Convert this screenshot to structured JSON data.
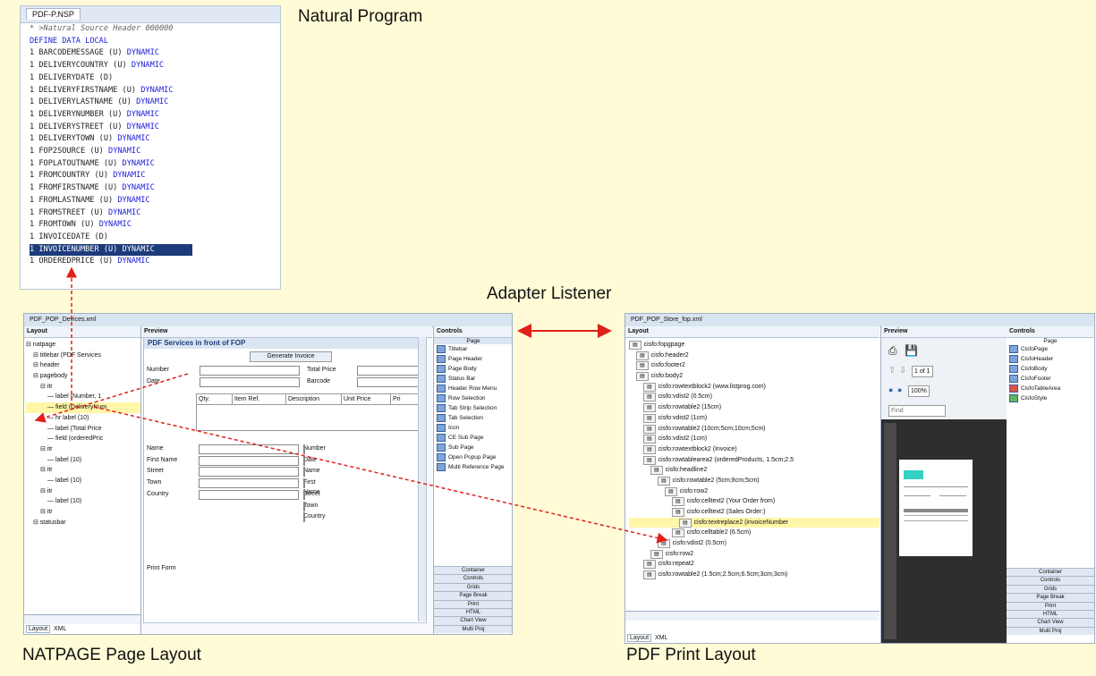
{
  "labels": {
    "natural_program": "Natural Program",
    "adapter_listener": "Adapter Listener",
    "natpage_layout": "NATPAGE Page Layout",
    "pdf_print_layout": "PDF Print Layout"
  },
  "code_editor": {
    "tab": "PDF-P.NSP",
    "lines": [
      "* >Natural Source Header 000000",
      "DEFINE DATA LOCAL",
      "1 BARCODEMESSAGE (U) DYNAMIC",
      "1 DELIVERYCOUNTRY (U) DYNAMIC",
      "1 DELIVERYDATE (D)",
      "1 DELIVERYFIRSTNAME (U) DYNAMIC",
      "1 DELIVERYLASTNAME (U) DYNAMIC",
      "1 DELIVERYNUMBER (U) DYNAMIC",
      "1 DELIVERYSTREET (U) DYNAMIC",
      "1 DELIVERYTOWN (U) DYNAMIC",
      "1 FOP2SOURCE (U) DYNAMIC",
      "1 FOPLATOUTNAME (U) DYNAMIC",
      "1 FROMCOUNTRY (U) DYNAMIC",
      "1 FROMFIRSTNAME (U) DYNAMIC",
      "1 FROMLASTNAME (U) DYNAMIC",
      "1 FROMSTREET (U) DYNAMIC",
      "1 FROMTOWN (U) DYNAMIC",
      "1 INVOICEDATE (D)",
      "1 INVOICENUMBER (U) DYNAMIC",
      "1 ORDEREDPRICE (U) DYNAMIC"
    ]
  },
  "natpage_window": {
    "tab": "PDF_POP_Devices.xml",
    "layout_header": "Layout",
    "preview_header": "Preview",
    "controls_header": "Controls",
    "tree": [
      "natpage",
      "titlebar (PDF Services",
      "header",
      "pagebody",
      "itr",
      "label (Number, 1",
      "field (DeliveryNum",
      "hr label (10)",
      "label (Total Price",
      "field (orderedPric",
      "itr",
      "label (10)",
      "itr",
      "label (10)",
      "itr",
      "label (10)",
      "itr",
      "statusbar"
    ],
    "preview_title": "PDF Services in front of FOP",
    "preview_button": "Generate Invoice",
    "form_left": [
      "Number",
      "Date"
    ],
    "form_right": [
      "Total Price",
      "Barcode"
    ],
    "grid_headers": [
      "Qty.",
      "Item Ref.",
      "Description",
      "Unit Price",
      "Pri"
    ],
    "from_fields": [
      "Name",
      "First Name",
      "Street",
      "Town",
      "Country"
    ],
    "to_fields": [
      "Number",
      "Date",
      "Name",
      "First Name",
      "Street",
      "Town",
      "Country"
    ],
    "print_form": "Print Form",
    "palette_header": "Page",
    "palette": [
      "Titlebar",
      "Page Header",
      "Page Body",
      "Status Bar",
      "Header Row Menu",
      "Row Selection",
      "Tab Strip Selection",
      "Tab Selection",
      "Icon",
      "CE Sub Page",
      "Sub Page",
      "Open Popup Page",
      "Multi Reference Page"
    ],
    "buttons": [
      "Container",
      "Controls",
      "Grids",
      "Page Break",
      "Print",
      "HTML",
      "Chart View",
      "Multi Proj"
    ],
    "bottom_tabs": [
      "Layout",
      "XML"
    ]
  },
  "pdf_window": {
    "tab": "PDF_POP_Store_fop.xml",
    "layout_header": "Layout",
    "preview_header": "Preview",
    "controls_header": "Controls",
    "tree": [
      "cisfo:fopgpage",
      "cisfo:header2",
      "cisfo:footer2",
      "cisfo:body2",
      "cisfo:rowtextblock2 (www.listprog.com)",
      "cisfo:vdist2 (0.5cm)",
      "cisfo:rowtable2 (15cm)",
      "cisfo:vdist2 (1cm)",
      "cisfo:rowtable2 (10cm;5cm;10cm;5cm)",
      "cisfo:vdist2 (1cm)",
      "cisfo:rowtextblock2 (Invoice)",
      "cisfo:rowtablearea2 (orderedProducts, 1.5cm;2.5",
      "cisfo:headline2",
      "cisfo:rowtable2 (5cm;8cm;5cm)",
      "cisfo:row2",
      "cisfo:celltext2 (Your Order from)",
      "cisfo:celltext2 (Sales Order:)",
      "cisfo:textreplace2 (invoiceNumber",
      "cisfo:celltable2 (6.5cm)",
      "cisfo:vdist2 (0.5cm)",
      "cisfo:row2",
      "cisfo:repeat2",
      "cisfo:rowtable2 (1.5cm;2.5cm;6.5cm;3cm;3cm)"
    ],
    "zoom": "100% ",
    "page_of": "1 of 1",
    "find": "Find",
    "palette_header": "Page",
    "palette": [
      "CisfoPage",
      "CisfoHeader",
      "CisfoBody",
      "CisfoFooter",
      "CisfoTableArea",
      "CisfoStyle"
    ],
    "buttons": [
      "Container",
      "Controls",
      "Grids",
      "Page Break",
      "Print",
      "HTML",
      "Chart View",
      "Multi Proj"
    ],
    "bottom_tabs": [
      "Layout",
      "XML"
    ]
  },
  "colors": {
    "background": "#fffbd6",
    "arrow": "#e0201a",
    "keyword": "#1b1bd6",
    "highlight": "#1d3b7a"
  }
}
